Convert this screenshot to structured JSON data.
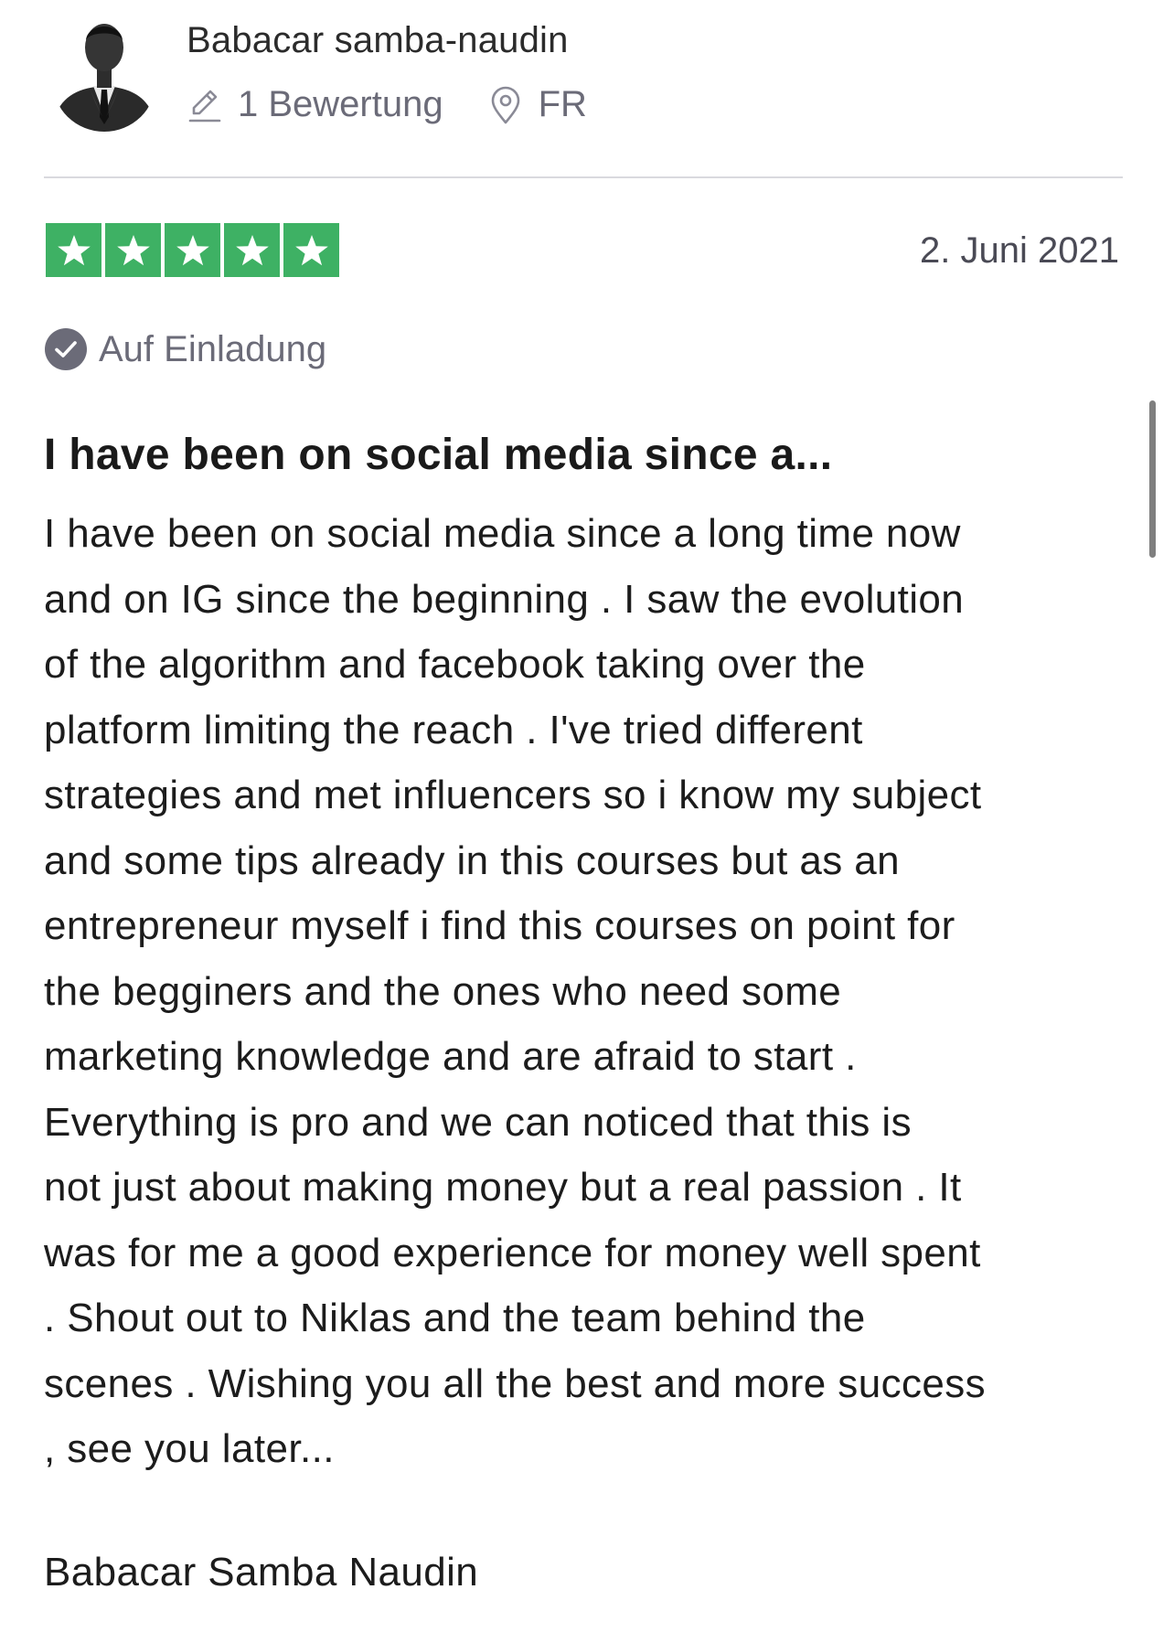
{
  "reviewer": {
    "name": "Babacar samba-naudin",
    "review_count": "1 Bewertung",
    "country": "FR",
    "avatar_icon": "user-avatar-photo",
    "pencil_icon": "pencil-icon",
    "location_icon": "location-pin-icon"
  },
  "review": {
    "rating": 5,
    "rating_max": 5,
    "star_color": "#3eb164",
    "date": "2. Juni 2021",
    "invited_label": "Auf Einladung",
    "invited_icon": "check-circle-icon",
    "title": "I have been on social media since a...",
    "body_lines": [
      "I have been on social media since a long time now",
      "and on IG since the beginning . I saw the evolution",
      "of the algorithm and facebook taking over the",
      "platform limiting the reach . I've tried different",
      "strategies and met influencers so i know my subject",
      "and some tips already in this courses but as an",
      "entrepreneur myself i find this courses on point for",
      "the begginers and the ones who need some",
      "marketing knowledge and are afraid to start .",
      "Everything is pro and we can noticed that this is",
      "not just about making money but a real passion . It",
      "was for me a good experience for money well spent",
      ". Shout out to Niklas and the team behind the",
      "scenes . Wishing you all the best and more success",
      ", see you later..."
    ],
    "signature": "Babacar Samba Naudin"
  }
}
